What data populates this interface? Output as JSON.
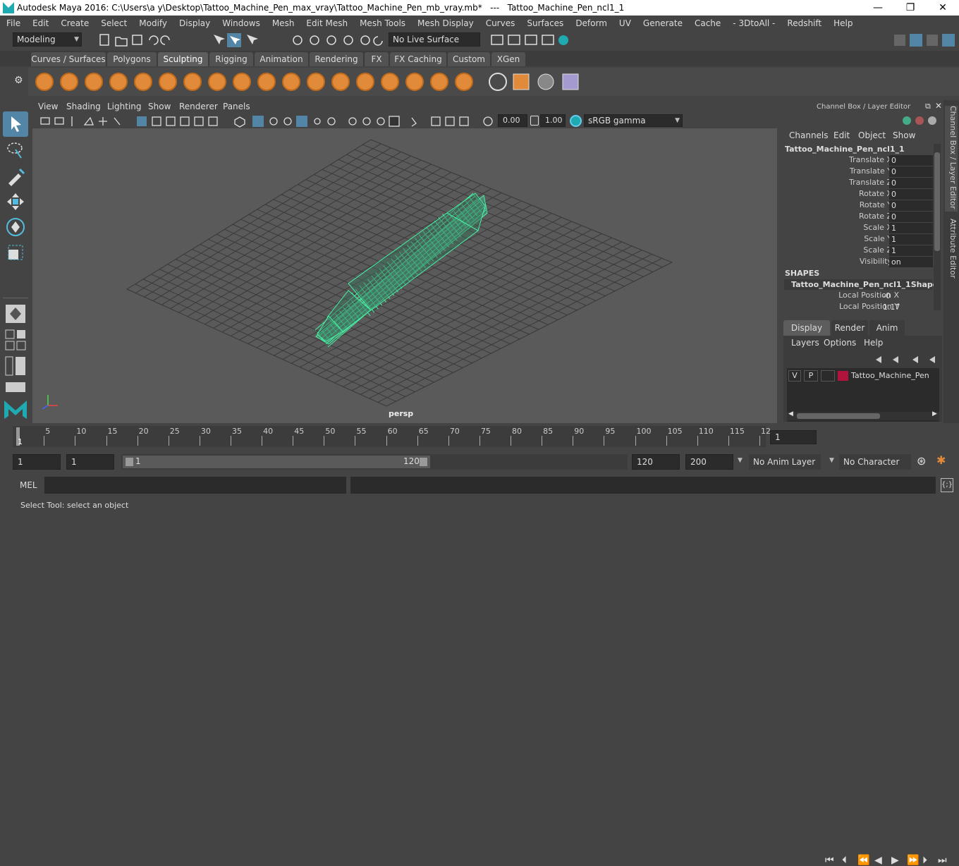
{
  "window": {
    "title": "Autodesk Maya 2016: C:\\Users\\a y\\Desktop\\Tattoo_Machine_Pen_max_vray\\Tattoo_Machine_Pen_mb_vray.mb*   ---   Tattoo_Machine_Pen_ncl1_1",
    "minimize": "—",
    "maximize": "❐",
    "close": "✕"
  },
  "menu": [
    "File",
    "Edit",
    "Create",
    "Select",
    "Modify",
    "Display",
    "Windows",
    "Mesh",
    "Edit Mesh",
    "Mesh Tools",
    "Mesh Display",
    "Curves",
    "Surfaces",
    "Deform",
    "UV",
    "Generate",
    "Cache",
    "- 3DtoAll -",
    "Redshift",
    "Help"
  ],
  "status": {
    "mode": "Modeling",
    "live_surface": "No Live Surface"
  },
  "shelf_tabs": [
    "Curves / Surfaces",
    "Polygons",
    "Sculpting",
    "Rigging",
    "Animation",
    "Rendering",
    "FX",
    "FX Caching",
    "Custom",
    "XGen"
  ],
  "shelf_active": "Sculpting",
  "viewport": {
    "menu": [
      "View",
      "Shading",
      "Lighting",
      "Show",
      "Renderer",
      "Panels"
    ],
    "exposure": "0.00",
    "gamma": "1.00",
    "color_space": "sRGB gamma",
    "camera_label": "persp"
  },
  "channel_box": {
    "header": "Channel Box / Layer Editor",
    "menu": [
      "Channels",
      "Edit",
      "Object",
      "Show"
    ],
    "object_name": "Tattoo_Machine_Pen_ncl1_1",
    "attributes": [
      {
        "label": "Translate X",
        "value": "0"
      },
      {
        "label": "Translate Y",
        "value": "0"
      },
      {
        "label": "Translate Z",
        "value": "0"
      },
      {
        "label": "Rotate X",
        "value": "0"
      },
      {
        "label": "Rotate Y",
        "value": "0"
      },
      {
        "label": "Rotate Z",
        "value": "0"
      },
      {
        "label": "Scale X",
        "value": "1"
      },
      {
        "label": "Scale Y",
        "value": "1"
      },
      {
        "label": "Scale Z",
        "value": "1"
      },
      {
        "label": "Visibility",
        "value": "on"
      }
    ],
    "shapes_header": "SHAPES",
    "shape_name": "Tattoo_Machine_Pen_ncl1_1Shape",
    "shape_attributes": [
      {
        "label": "Local Position X",
        "value": "-0"
      },
      {
        "label": "Local Position Y",
        "value": "1.17"
      }
    ]
  },
  "layer_editor": {
    "tabs": [
      "Display",
      "Render",
      "Anim"
    ],
    "active_tab": "Display",
    "menu": [
      "Layers",
      "Options",
      "Help"
    ],
    "layer": {
      "v": "V",
      "p": "P",
      "name": "Tattoo_Machine_Pen",
      "color": "#b0143c"
    }
  },
  "side_tabs": [
    "Channel Box / Layer Editor",
    "Attribute Editor"
  ],
  "timeline": {
    "ticks": [
      "1",
      "5",
      "10",
      "15",
      "20",
      "25",
      "30",
      "35",
      "40",
      "45",
      "50",
      "55",
      "60",
      "65",
      "70",
      "75",
      "80",
      "85",
      "90",
      "95",
      "100",
      "105",
      "110",
      "115",
      "12"
    ],
    "current_frame": "1"
  },
  "range": {
    "start": "1",
    "playback_start": "1",
    "slider_start": "1",
    "slider_end": "120",
    "playback_end": "120",
    "end": "200",
    "anim_layer": "No Anim Layer",
    "character_set": "No Character Set"
  },
  "cmdline": {
    "label": "MEL"
  },
  "help_line": "Select Tool: select an object",
  "colors": {
    "accent": "#5285a6",
    "wire": "#45f5a5",
    "shelf_icon": "#e08a3a"
  }
}
